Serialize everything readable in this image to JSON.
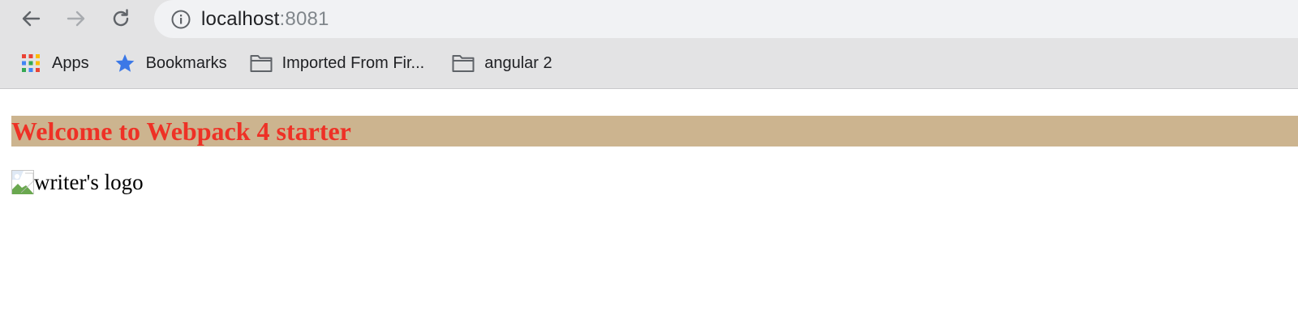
{
  "browser": {
    "url_host": "localhost",
    "url_port": ":8081",
    "bookmarks": [
      {
        "label": "Apps",
        "icon": "apps-grid-icon"
      },
      {
        "label": "Bookmarks",
        "icon": "star-icon"
      },
      {
        "label": "Imported From Fir...",
        "icon": "folder-icon"
      },
      {
        "label": "angular 2",
        "icon": "folder-icon"
      }
    ]
  },
  "page": {
    "heading": "Welcome to Webpack 4 starter",
    "logo_alt": "writer's logo"
  },
  "colors": {
    "heading_text": "#ee3126",
    "heading_background": "#ccb48f",
    "star": "#3b78e7"
  }
}
